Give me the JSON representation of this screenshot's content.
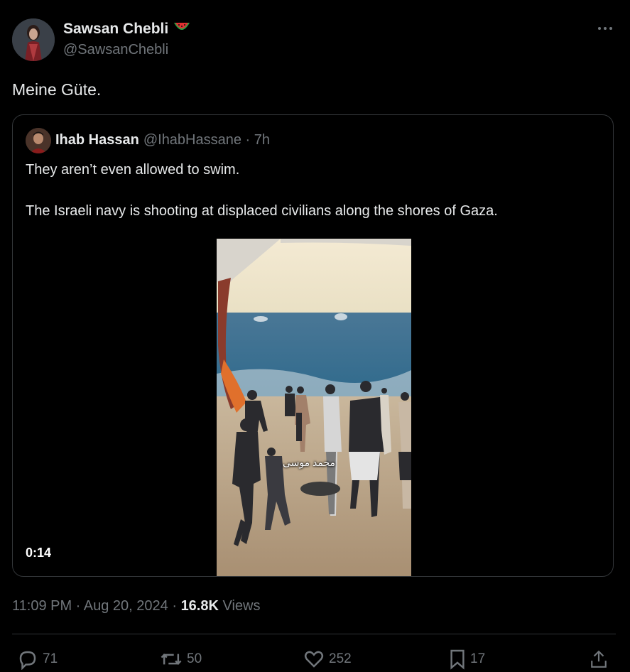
{
  "author": {
    "name": "Sawsan Chebli",
    "handle": "@SawsanChebli",
    "badge_icon": "watermelon-icon"
  },
  "tweet": {
    "text": "Meine Güte."
  },
  "quoted": {
    "name": "Ihab Hassan",
    "meta": "@IhabHassane · 7h",
    "line1": "They aren’t even allowed to swim.",
    "line2": "The Israeli navy is shooting at displaced civilians along the shores of Gaza.",
    "video_caption": "محمد موسى",
    "duration": "0:14"
  },
  "meta": {
    "time": "11:09 PM · Aug 20, 2024 · ",
    "views_count": "16.8K",
    "views_label": " Views"
  },
  "actions": {
    "replies": "71",
    "reposts": "50",
    "likes": "252",
    "bookmarks": "17"
  },
  "colors": {
    "background": "#000000",
    "text": "#e7e9ea",
    "muted": "#71767b",
    "border": "#333639"
  }
}
